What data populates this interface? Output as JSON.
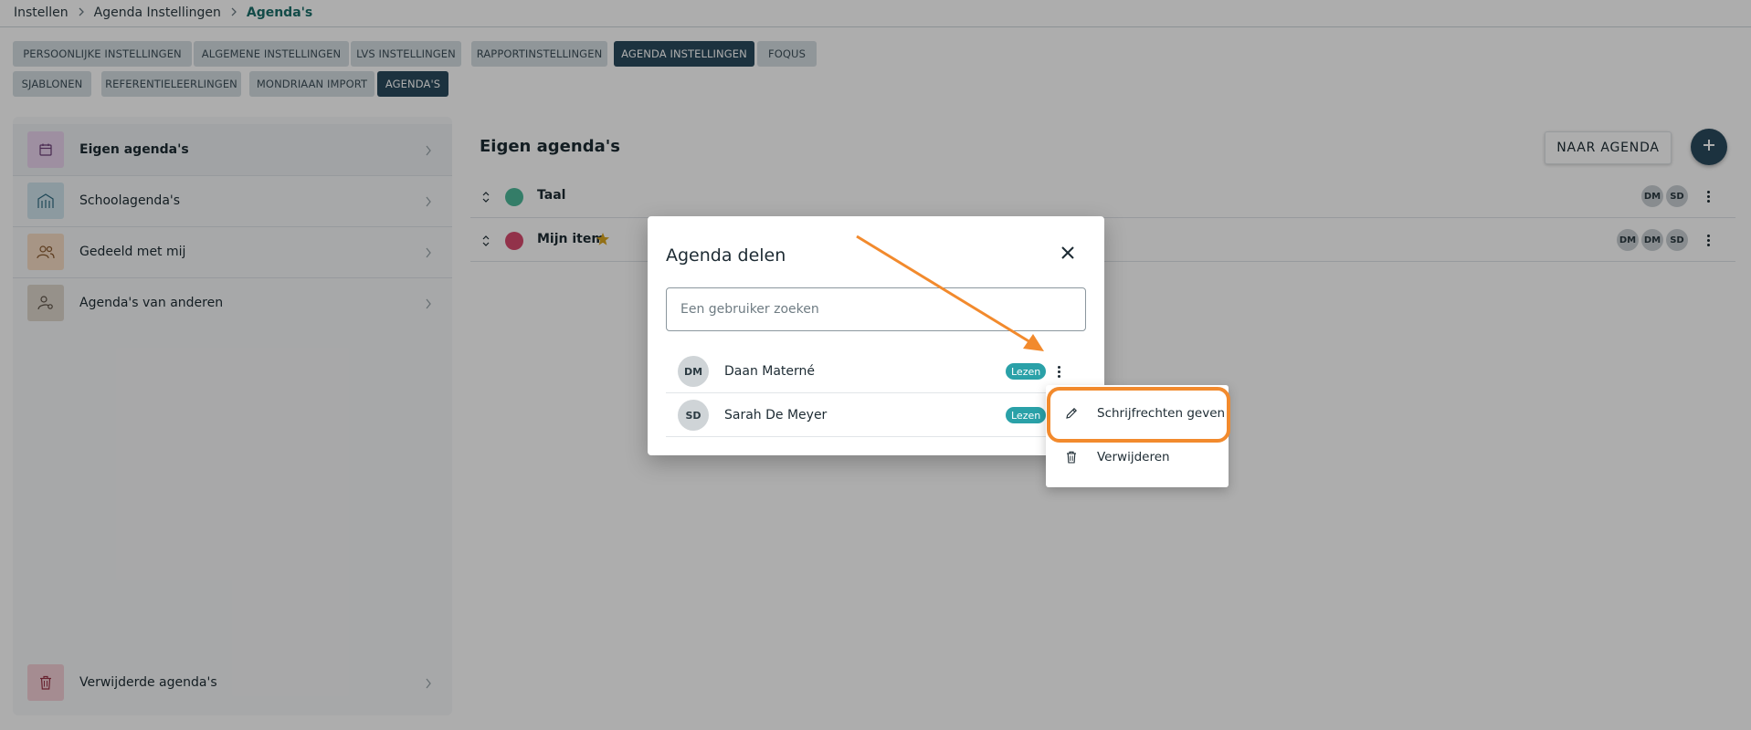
{
  "breadcrumb": {
    "items": [
      "Instellen",
      "Agenda Instellingen"
    ],
    "current": "Agenda's"
  },
  "tabs": {
    "row1": [
      "PERSOONLIJKE INSTELLINGEN",
      "ALGEMENE INSTELLINGEN",
      "LVS INSTELLINGEN",
      "RAPPORTINSTELLINGEN",
      "AGENDA INSTELLINGEN",
      "FOQUS"
    ],
    "row2": [
      "SJABLONEN",
      "REFERENTIELEERLINGEN",
      "MONDRIAAN IMPORT",
      "AGENDA'S"
    ],
    "active_row1": "AGENDA INSTELLINGEN",
    "active_row2": "AGENDA'S"
  },
  "sidebar": {
    "items": [
      {
        "label": "Eigen agenda's",
        "icon": "calendar-icon",
        "color": "#e9d3ee"
      },
      {
        "label": "Schoolagenda's",
        "icon": "school-building-icon",
        "color": "#cfe4ec"
      },
      {
        "label": "Gedeeld met mij",
        "icon": "users-icon",
        "color": "#f6dcc4"
      },
      {
        "label": "Agenda's van anderen",
        "icon": "user-settings-icon",
        "color": "#ded6cc"
      }
    ],
    "deleted": {
      "label": "Verwijderde agenda's",
      "icon": "trash-icon",
      "color": "#f3cfd6"
    }
  },
  "main": {
    "title": "Eigen agenda's",
    "naar_agenda_label": "NAAR AGENDA",
    "add_icon": "plus-icon",
    "rows": [
      {
        "name": "Taal",
        "color": "#4db89a",
        "starred": false,
        "avatars": [
          "DM",
          "SD"
        ]
      },
      {
        "name": "Mijn item",
        "color": "#d84a6e",
        "starred": true,
        "avatars": [
          "DM",
          "DM",
          "SD"
        ]
      }
    ]
  },
  "dialog": {
    "title": "Agenda delen",
    "search_placeholder": "Een gebruiker zoeken",
    "search_value": "",
    "users": [
      {
        "initials": "DM",
        "name": "Daan Materné",
        "role": "Lezen"
      },
      {
        "initials": "SD",
        "name": "Sarah De Meyer",
        "role": "Lezen"
      }
    ]
  },
  "context_menu": {
    "items": [
      {
        "label": "Schrijfrechten geven",
        "icon": "pencil-icon"
      },
      {
        "label": "Verwijderen",
        "icon": "trash-icon"
      }
    ]
  },
  "colors": {
    "accent_dark": "#2a4a5d",
    "badge_teal": "#2aa1a8",
    "annotation_orange": "#f28a2d",
    "breadcrumb_current": "#1b6f6a"
  }
}
